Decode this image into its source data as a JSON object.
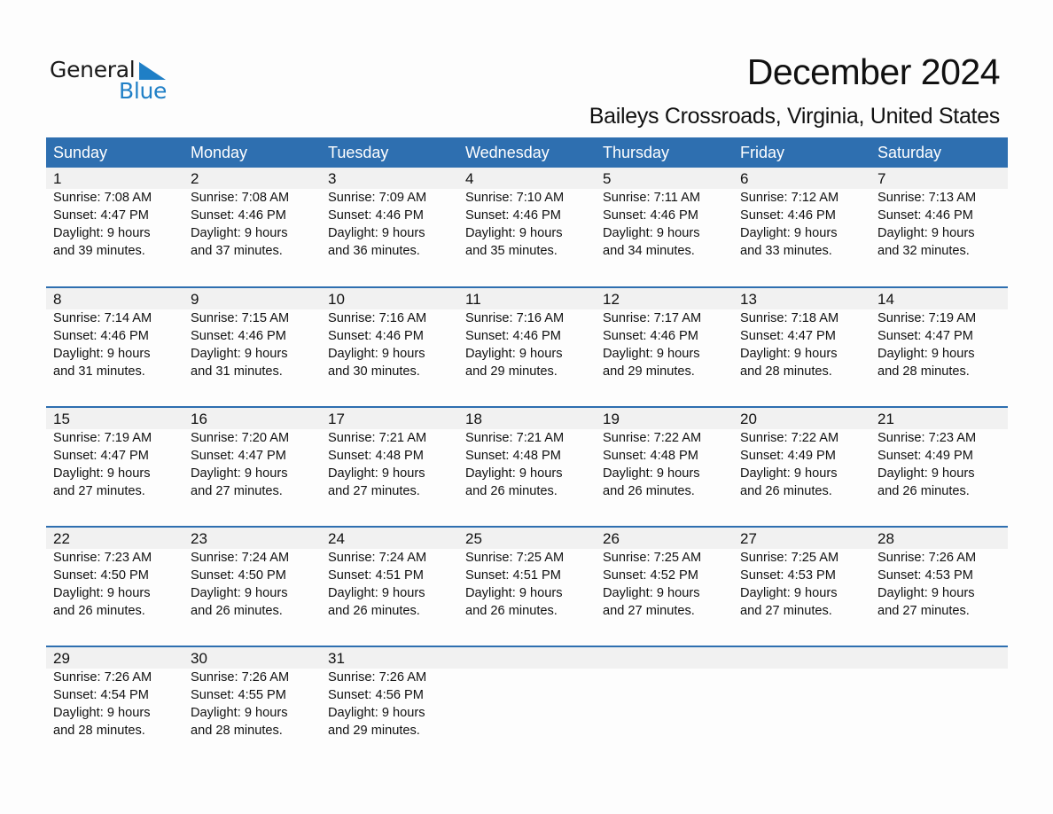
{
  "logo": {
    "general": "General",
    "blue": "Blue"
  },
  "title": "December 2024",
  "location": "Baileys Crossroads, Virginia, United States",
  "colors": {
    "header_bg": "#2e6fb0",
    "band_bg": "#f1f1f1",
    "logo_blue": "#1f7fc6"
  },
  "weekdays": [
    "Sunday",
    "Monday",
    "Tuesday",
    "Wednesday",
    "Thursday",
    "Friday",
    "Saturday"
  ],
  "weeks": [
    [
      {
        "day": "1",
        "sunrise": "Sunrise: 7:08 AM",
        "sunset": "Sunset: 4:47 PM",
        "daylight1": "Daylight: 9 hours",
        "daylight2": "and 39 minutes."
      },
      {
        "day": "2",
        "sunrise": "Sunrise: 7:08 AM",
        "sunset": "Sunset: 4:46 PM",
        "daylight1": "Daylight: 9 hours",
        "daylight2": "and 37 minutes."
      },
      {
        "day": "3",
        "sunrise": "Sunrise: 7:09 AM",
        "sunset": "Sunset: 4:46 PM",
        "daylight1": "Daylight: 9 hours",
        "daylight2": "and 36 minutes."
      },
      {
        "day": "4",
        "sunrise": "Sunrise: 7:10 AM",
        "sunset": "Sunset: 4:46 PM",
        "daylight1": "Daylight: 9 hours",
        "daylight2": "and 35 minutes."
      },
      {
        "day": "5",
        "sunrise": "Sunrise: 7:11 AM",
        "sunset": "Sunset: 4:46 PM",
        "daylight1": "Daylight: 9 hours",
        "daylight2": "and 34 minutes."
      },
      {
        "day": "6",
        "sunrise": "Sunrise: 7:12 AM",
        "sunset": "Sunset: 4:46 PM",
        "daylight1": "Daylight: 9 hours",
        "daylight2": "and 33 minutes."
      },
      {
        "day": "7",
        "sunrise": "Sunrise: 7:13 AM",
        "sunset": "Sunset: 4:46 PM",
        "daylight1": "Daylight: 9 hours",
        "daylight2": "and 32 minutes."
      }
    ],
    [
      {
        "day": "8",
        "sunrise": "Sunrise: 7:14 AM",
        "sunset": "Sunset: 4:46 PM",
        "daylight1": "Daylight: 9 hours",
        "daylight2": "and 31 minutes."
      },
      {
        "day": "9",
        "sunrise": "Sunrise: 7:15 AM",
        "sunset": "Sunset: 4:46 PM",
        "daylight1": "Daylight: 9 hours",
        "daylight2": "and 31 minutes."
      },
      {
        "day": "10",
        "sunrise": "Sunrise: 7:16 AM",
        "sunset": "Sunset: 4:46 PM",
        "daylight1": "Daylight: 9 hours",
        "daylight2": "and 30 minutes."
      },
      {
        "day": "11",
        "sunrise": "Sunrise: 7:16 AM",
        "sunset": "Sunset: 4:46 PM",
        "daylight1": "Daylight: 9 hours",
        "daylight2": "and 29 minutes."
      },
      {
        "day": "12",
        "sunrise": "Sunrise: 7:17 AM",
        "sunset": "Sunset: 4:46 PM",
        "daylight1": "Daylight: 9 hours",
        "daylight2": "and 29 minutes."
      },
      {
        "day": "13",
        "sunrise": "Sunrise: 7:18 AM",
        "sunset": "Sunset: 4:47 PM",
        "daylight1": "Daylight: 9 hours",
        "daylight2": "and 28 minutes."
      },
      {
        "day": "14",
        "sunrise": "Sunrise: 7:19 AM",
        "sunset": "Sunset: 4:47 PM",
        "daylight1": "Daylight: 9 hours",
        "daylight2": "and 28 minutes."
      }
    ],
    [
      {
        "day": "15",
        "sunrise": "Sunrise: 7:19 AM",
        "sunset": "Sunset: 4:47 PM",
        "daylight1": "Daylight: 9 hours",
        "daylight2": "and 27 minutes."
      },
      {
        "day": "16",
        "sunrise": "Sunrise: 7:20 AM",
        "sunset": "Sunset: 4:47 PM",
        "daylight1": "Daylight: 9 hours",
        "daylight2": "and 27 minutes."
      },
      {
        "day": "17",
        "sunrise": "Sunrise: 7:21 AM",
        "sunset": "Sunset: 4:48 PM",
        "daylight1": "Daylight: 9 hours",
        "daylight2": "and 27 minutes."
      },
      {
        "day": "18",
        "sunrise": "Sunrise: 7:21 AM",
        "sunset": "Sunset: 4:48 PM",
        "daylight1": "Daylight: 9 hours",
        "daylight2": "and 26 minutes."
      },
      {
        "day": "19",
        "sunrise": "Sunrise: 7:22 AM",
        "sunset": "Sunset: 4:48 PM",
        "daylight1": "Daylight: 9 hours",
        "daylight2": "and 26 minutes."
      },
      {
        "day": "20",
        "sunrise": "Sunrise: 7:22 AM",
        "sunset": "Sunset: 4:49 PM",
        "daylight1": "Daylight: 9 hours",
        "daylight2": "and 26 minutes."
      },
      {
        "day": "21",
        "sunrise": "Sunrise: 7:23 AM",
        "sunset": "Sunset: 4:49 PM",
        "daylight1": "Daylight: 9 hours",
        "daylight2": "and 26 minutes."
      }
    ],
    [
      {
        "day": "22",
        "sunrise": "Sunrise: 7:23 AM",
        "sunset": "Sunset: 4:50 PM",
        "daylight1": "Daylight: 9 hours",
        "daylight2": "and 26 minutes."
      },
      {
        "day": "23",
        "sunrise": "Sunrise: 7:24 AM",
        "sunset": "Sunset: 4:50 PM",
        "daylight1": "Daylight: 9 hours",
        "daylight2": "and 26 minutes."
      },
      {
        "day": "24",
        "sunrise": "Sunrise: 7:24 AM",
        "sunset": "Sunset: 4:51 PM",
        "daylight1": "Daylight: 9 hours",
        "daylight2": "and 26 minutes."
      },
      {
        "day": "25",
        "sunrise": "Sunrise: 7:25 AM",
        "sunset": "Sunset: 4:51 PM",
        "daylight1": "Daylight: 9 hours",
        "daylight2": "and 26 minutes."
      },
      {
        "day": "26",
        "sunrise": "Sunrise: 7:25 AM",
        "sunset": "Sunset: 4:52 PM",
        "daylight1": "Daylight: 9 hours",
        "daylight2": "and 27 minutes."
      },
      {
        "day": "27",
        "sunrise": "Sunrise: 7:25 AM",
        "sunset": "Sunset: 4:53 PM",
        "daylight1": "Daylight: 9 hours",
        "daylight2": "and 27 minutes."
      },
      {
        "day": "28",
        "sunrise": "Sunrise: 7:26 AM",
        "sunset": "Sunset: 4:53 PM",
        "daylight1": "Daylight: 9 hours",
        "daylight2": "and 27 minutes."
      }
    ],
    [
      {
        "day": "29",
        "sunrise": "Sunrise: 7:26 AM",
        "sunset": "Sunset: 4:54 PM",
        "daylight1": "Daylight: 9 hours",
        "daylight2": "and 28 minutes."
      },
      {
        "day": "30",
        "sunrise": "Sunrise: 7:26 AM",
        "sunset": "Sunset: 4:55 PM",
        "daylight1": "Daylight: 9 hours",
        "daylight2": "and 28 minutes."
      },
      {
        "day": "31",
        "sunrise": "Sunrise: 7:26 AM",
        "sunset": "Sunset: 4:56 PM",
        "daylight1": "Daylight: 9 hours",
        "daylight2": "and 29 minutes."
      },
      null,
      null,
      null,
      null
    ]
  ]
}
